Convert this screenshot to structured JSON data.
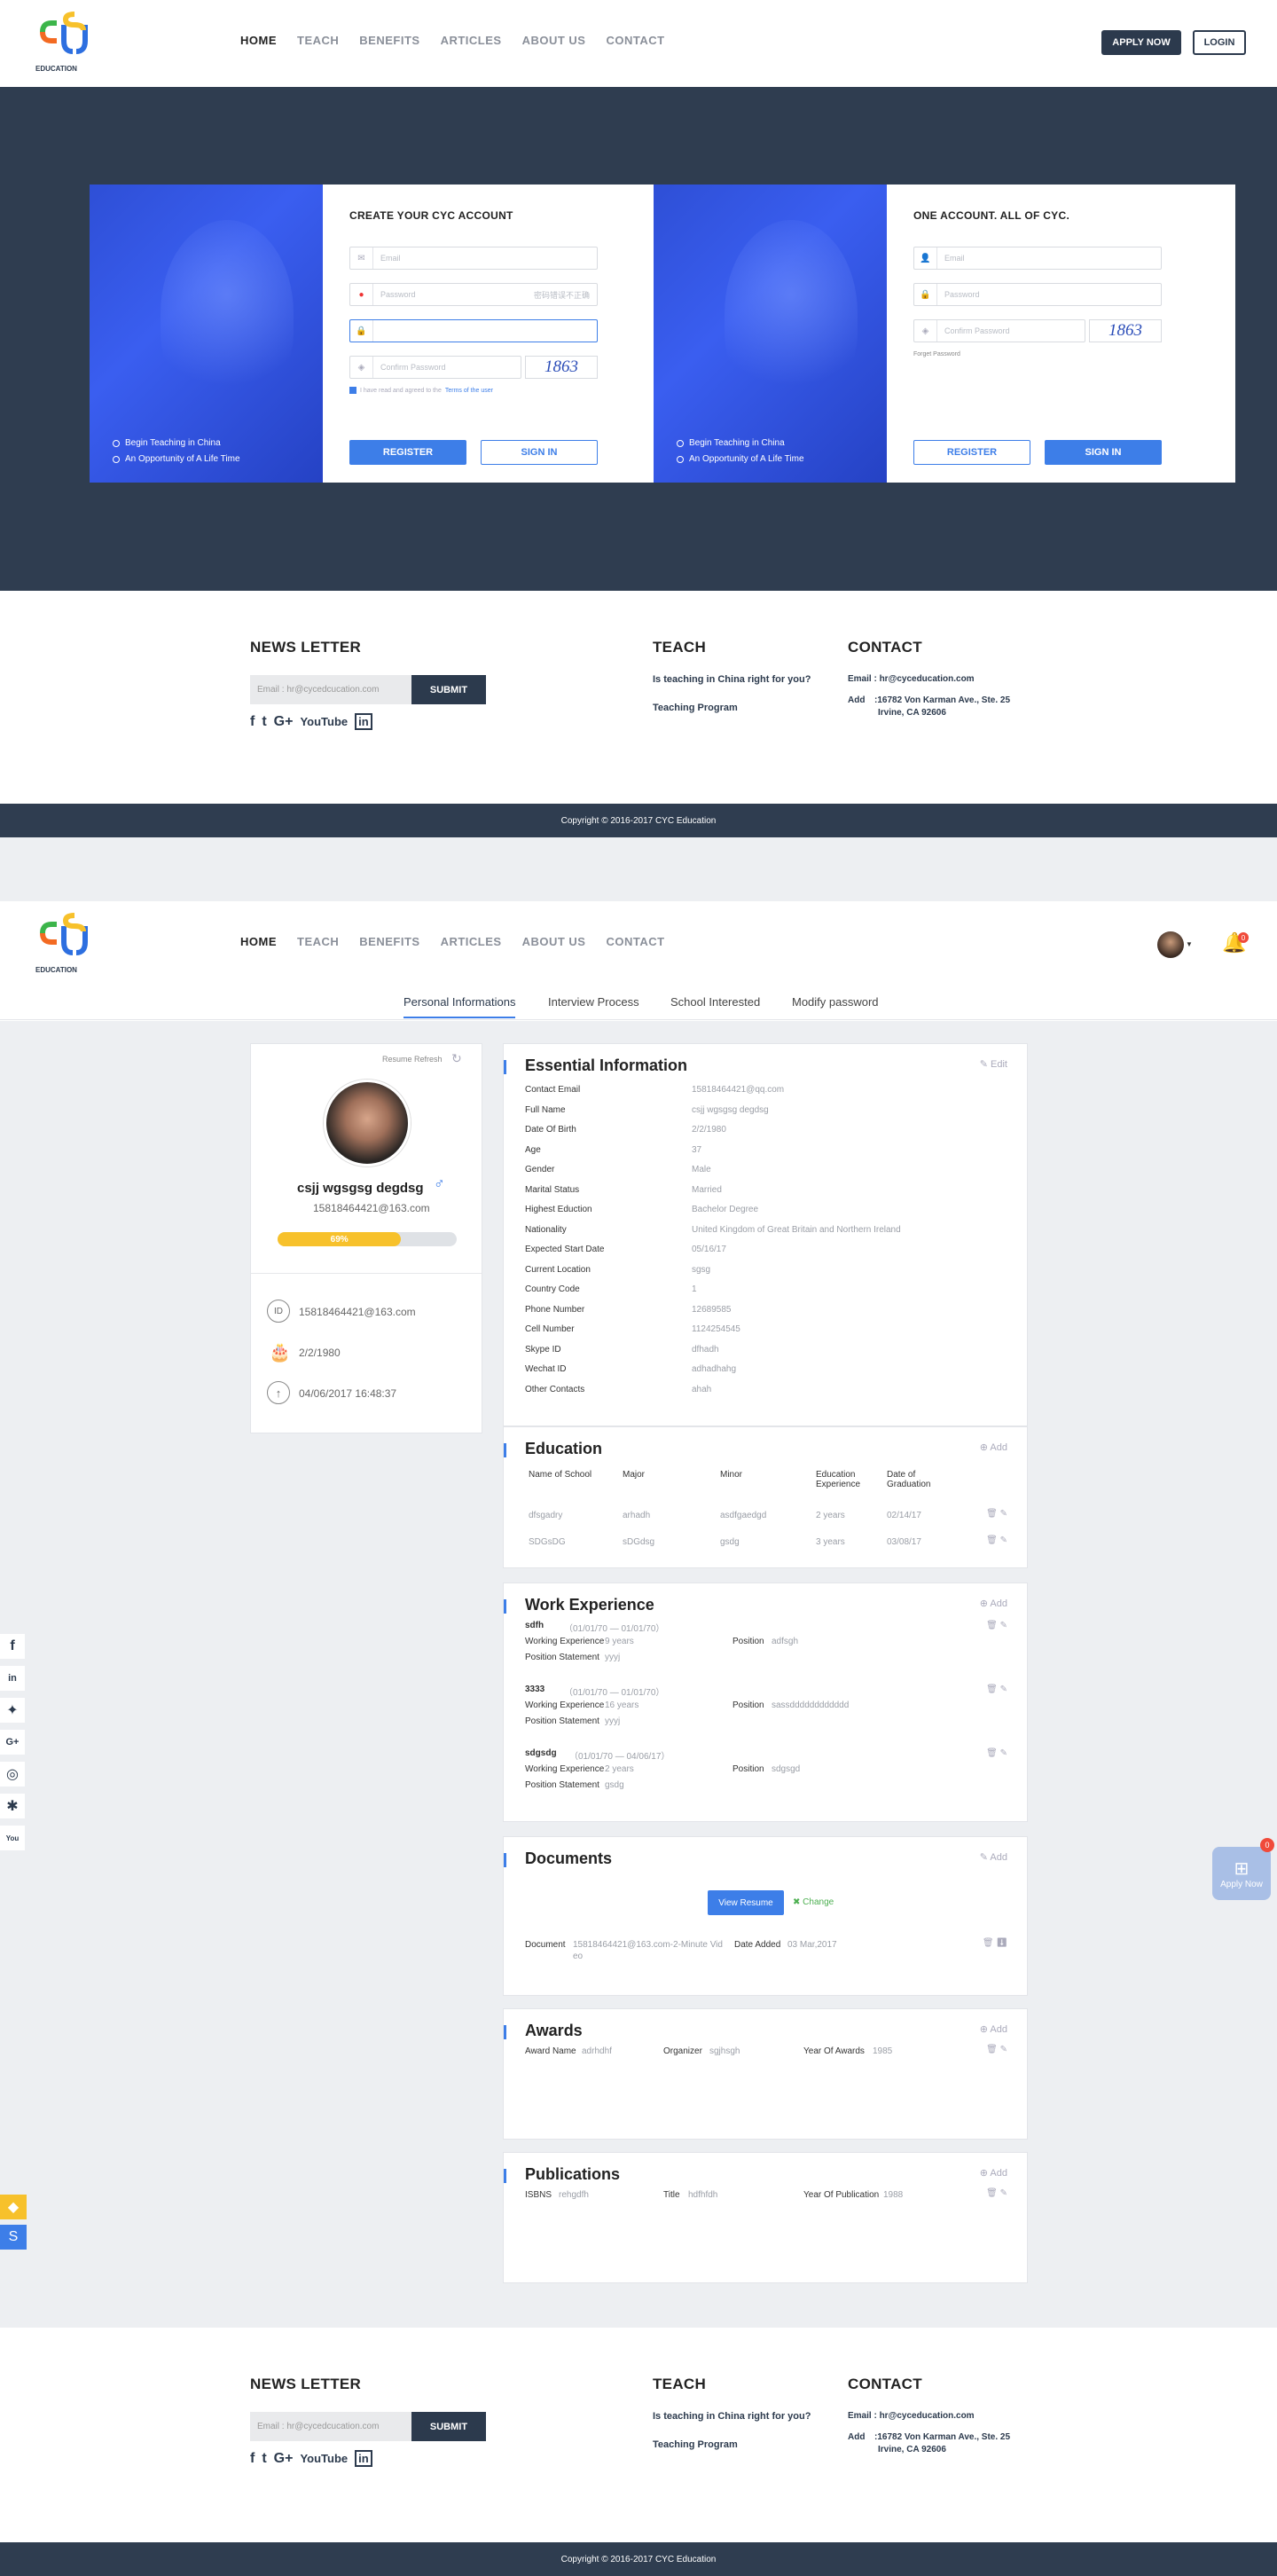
{
  "nav": {
    "items": [
      "HOME",
      "TEACH",
      "BENEFITS",
      "ARTICLES",
      "ABOUT US",
      "CONTACT"
    ],
    "apply": "APPLY NOW",
    "login": "LOGIN",
    "logo_text": "EDUCATION"
  },
  "register_card": {
    "title": "CREATE YOUR CYC ACCOUNT",
    "email_ph": "Email",
    "password_ph": "Password",
    "password_hint": "密码错误不正确",
    "confirm_ph": "Confirm Password",
    "captcha": "1863",
    "terms_pre": "I have read and agreed to the",
    "terms_link": "Terms of the user",
    "register": "REGISTER",
    "signin": "SIGN IN",
    "bullets": [
      "Begin Teaching in China",
      "An Opportunity of A Life Time"
    ]
  },
  "login_card": {
    "title": "ONE ACCOUNT. ALL OF CYC.",
    "email_ph": "Email",
    "password_ph": "Password",
    "confirm_ph": "Confirm Password",
    "captcha": "1863",
    "forget": "Forget Password",
    "register": "REGISTER",
    "signin": "SIGN IN",
    "bullets": [
      "Begin Teaching in China",
      "An Opportunity of A Life Time"
    ]
  },
  "footer": {
    "newsletter": "NEWS LETTER",
    "email_ph": "Email : hr@cycedcucation.com",
    "submit": "SUBMIT",
    "social": [
      "f",
      "t",
      "G+",
      "YouTube",
      "in"
    ],
    "teach": "TEACH",
    "teach_links": [
      "Is teaching in China right for you?",
      "Teaching Program"
    ],
    "contact": "CONTACT",
    "contact_email": "Email : hr@cyceducation.com",
    "addr_label": "Add",
    "addr_line1": ":16782 Von Karman Ave., Ste. 25",
    "addr_line2": "Irvine, CA 92606",
    "copyright": "Copyright © 2016-2017 CYC Education"
  },
  "profile_tabs": [
    "Personal Informations",
    "Interview Process",
    "School Interested",
    "Modify password"
  ],
  "notification_count": "0",
  "profile": {
    "refresh": "Resume Refresh",
    "name": "csjj wgsgsg degdsg",
    "email": "15818464421@163.com",
    "progress_label": "69%",
    "progress": 0.69,
    "detail_email": "15818464421@163.com",
    "birth": "2/2/1980",
    "time": "04/06/2017 16:48:37"
  },
  "essential": {
    "title": "Essential Information",
    "edit": "Edit",
    "rows": [
      [
        "Contact Email",
        "15818464421@qq.com"
      ],
      [
        "Full Name",
        "csjj wgsgsg degdsg"
      ],
      [
        "Date Of Birth",
        "2/2/1980"
      ],
      [
        "Age",
        "37"
      ],
      [
        "Gender",
        "Male"
      ],
      [
        "Marital Status",
        "Married"
      ],
      [
        "Highest Eduction",
        "Bachelor Degree"
      ],
      [
        "Nationality",
        "United Kingdom of Great Britain and Northern Ireland"
      ],
      [
        "Expected Start Date",
        "05/16/17"
      ],
      [
        "Current Location",
        "sgsg"
      ],
      [
        "Country Code",
        "1"
      ],
      [
        "Phone Number",
        "12689585"
      ],
      [
        "Cell Number",
        "1124254545"
      ],
      [
        "Skype ID",
        "dfhadh"
      ],
      [
        "Wechat ID",
        "adhadhahg"
      ],
      [
        "Other Contacts",
        "ahah"
      ]
    ]
  },
  "education": {
    "title": "Education",
    "add": "Add",
    "headers": [
      "Name of School",
      "Major",
      "Minor",
      "Education Experience",
      "Date of Graduation"
    ],
    "rows": [
      [
        "dfsgadry",
        "arhadh",
        "asdfgaedgd",
        "2 years",
        "02/14/17"
      ],
      [
        "SDGsDG",
        "sDGdsg",
        "gsdg",
        "3 years",
        "03/08/17"
      ]
    ]
  },
  "work": {
    "title": "Work Experience",
    "add": "Add",
    "entries": [
      {
        "name": "sdfh",
        "dates": "（01/01/70 — 01/01/70）",
        "exp_label": "Working Experience",
        "exp": "9 years",
        "pos_label": "Position",
        "pos": "adfsgh",
        "stmt_label": "Position Statement",
        "stmt": "yyyj"
      },
      {
        "name": "3333",
        "dates": "（01/01/70 — 01/01/70）",
        "exp_label": "Working Experience",
        "exp": "16 years",
        "pos_label": "Position",
        "pos": "sassdddddddddddd",
        "stmt_label": "Position Statement",
        "stmt": "yyyj"
      },
      {
        "name": "sdgsdg",
        "dates": "（01/01/70 — 04/06/17）",
        "exp_label": "Working Experience",
        "exp": "2 years",
        "pos_label": "Position",
        "pos": "sdgsgd",
        "stmt_label": "Position Statement",
        "stmt": "gsdg"
      }
    ]
  },
  "documents": {
    "title": "Documents",
    "add": "Add",
    "view": "View Resume",
    "change": "Change",
    "doc_label": "Document",
    "doc_val1": "15818464421@163.com-2-Minute Vid",
    "doc_val2": "eo",
    "date_label": "Date Added",
    "date_val": "03 Mar,2017"
  },
  "awards": {
    "title": "Awards",
    "add": "Add",
    "name_label": "Award Name",
    "name": "adrhdhf",
    "org_label": "Organizer",
    "org": "sgjhsgh",
    "year_label": "Year Of Awards",
    "year": "1985"
  },
  "publications": {
    "title": "Publications",
    "add": "Add",
    "isbn_label": "ISBNS",
    "isbn": "rehgdfh",
    "title_label": "Title",
    "title_val": "hdfhfdh",
    "year_label": "Year Of Publication",
    "year": "1988"
  },
  "apply_float": {
    "label": "Apply Now",
    "count": "0"
  },
  "colors": {
    "navy": "#2f3d50",
    "blue": "#3d7ee8",
    "yellow": "#f7c12b"
  }
}
